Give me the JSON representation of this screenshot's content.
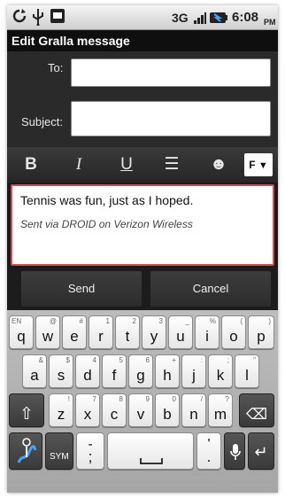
{
  "status_bar": {
    "network": "3G",
    "time": "6:08",
    "ampm": "PM",
    "icons": [
      "sync-icon",
      "usb-icon",
      "notification-icon",
      "signal-icon",
      "battery-icon"
    ]
  },
  "title": "Edit Gralla message",
  "form": {
    "to_label": "To:",
    "to_value": "",
    "subject_label": "Subject:",
    "subject_value": ""
  },
  "format_toolbar": {
    "bold": "B",
    "italic": "I",
    "underline": "U",
    "list": "☰",
    "emoji": "☻",
    "font": "F",
    "font_arrow": "▼"
  },
  "message": {
    "body": "Tennis was fun, just as I hoped.",
    "signature": "Sent via DROID on Verizon Wireless"
  },
  "actions": {
    "send": "Send",
    "cancel": "Cancel"
  },
  "keyboard": {
    "row1": [
      {
        "main": "q",
        "alt": "EN"
      },
      {
        "main": "w",
        "alt": "@"
      },
      {
        "main": "e",
        "alt": "#"
      },
      {
        "main": "r",
        "alt": "1"
      },
      {
        "main": "t",
        "alt": "2"
      },
      {
        "main": "y",
        "alt": "3"
      },
      {
        "main": "u",
        "alt": "_"
      },
      {
        "main": "i",
        "alt": "%"
      },
      {
        "main": "o",
        "alt": "("
      },
      {
        "main": "p",
        "alt": ")"
      }
    ],
    "row2": [
      {
        "main": "a",
        "alt": "&"
      },
      {
        "main": "s",
        "alt": "$"
      },
      {
        "main": "d",
        "alt": "4"
      },
      {
        "main": "f",
        "alt": "5"
      },
      {
        "main": "g",
        "alt": "6"
      },
      {
        "main": "h",
        "alt": "+"
      },
      {
        "main": "j",
        "alt": ":"
      },
      {
        "main": "k",
        "alt": ";"
      },
      {
        "main": "l",
        "alt": "\""
      }
    ],
    "row3": [
      {
        "main": "z",
        "alt": "!"
      },
      {
        "main": "x",
        "alt": "7"
      },
      {
        "main": "c",
        "alt": "8"
      },
      {
        "main": "v",
        "alt": "9"
      },
      {
        "main": "b",
        "alt": "0"
      },
      {
        "main": "n",
        "alt": "/"
      },
      {
        "main": "m",
        "alt": "?"
      }
    ],
    "shift": "⇧",
    "backspace": "⌫",
    "sym": "SYM",
    "dash": "-",
    "semicolon": ";",
    "apostrophe": "'",
    "period": ".",
    "mic": "🎤",
    "enter": "↵"
  },
  "colors": {
    "body_border": "#d84a4a",
    "accent": "#4aa3ff"
  }
}
